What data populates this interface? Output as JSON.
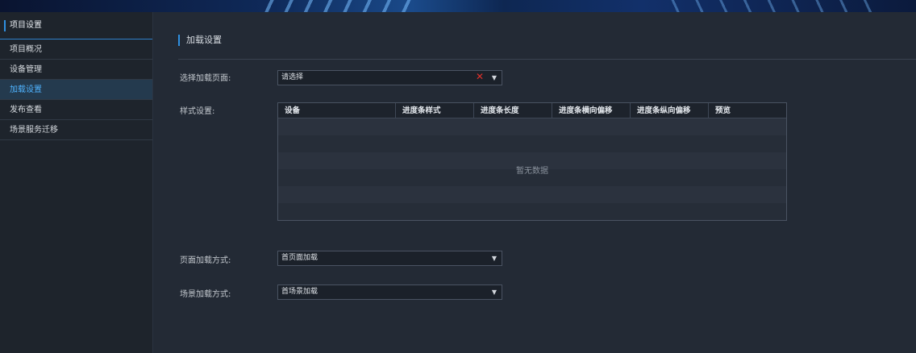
{
  "sidebar": {
    "header": "项目设置",
    "items": [
      {
        "label": "项目概况"
      },
      {
        "label": "设备管理"
      },
      {
        "label": "加载设置"
      },
      {
        "label": "发布查看"
      },
      {
        "label": "场景服务迁移"
      }
    ]
  },
  "main": {
    "title": "加载设置",
    "load_page": {
      "label": "选择加载页面:",
      "value": "请选择"
    },
    "style": {
      "label": "样式设置:",
      "columns": [
        "设备",
        "进度条样式",
        "进度条长度",
        "进度条横向偏移",
        "进度条纵向偏移",
        "预览"
      ],
      "empty_text": "暂无数据"
    },
    "page_load_mode": {
      "label": "页面加载方式:",
      "value": "首页面加载"
    },
    "scene_load_mode": {
      "label": "场景加载方式:",
      "value": "首场景加载"
    }
  },
  "colors": {
    "accent": "#2f8fe0",
    "active_text": "#4fb3ff",
    "clear_icon": "#e0302a"
  },
  "icons": {
    "clear": "close-icon",
    "dropdown": "chevron-down-icon"
  }
}
